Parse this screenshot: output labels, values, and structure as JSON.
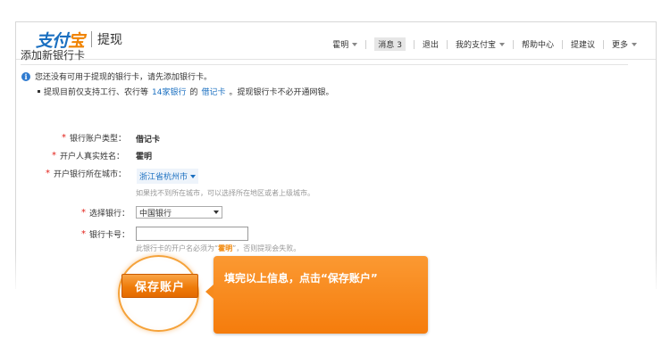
{
  "header": {
    "logo_text_1": "支付",
    "logo_text_2": "宝",
    "section": "提现",
    "nav": {
      "user": "霍明",
      "messages_label": "消息",
      "messages_count": "3",
      "logout": "退出",
      "my_alipay": "我的支付宝",
      "help": "帮助中心",
      "suggest": "提建议",
      "more": "更多"
    }
  },
  "page": {
    "title": "添加新银行卡",
    "notice": "您还没有可用于提现的银行卡，请先添加银行卡。",
    "note_prefix": "提现目前仅支持工行、农行等",
    "note_link1": "14家银行",
    "note_mid": "的",
    "note_link2": "借记卡",
    "note_suffix": "。提现银行卡不必开通网银。"
  },
  "form": {
    "required_mark": "*",
    "account_type_label": "银行账户类型：",
    "account_type_value": "借记卡",
    "holder_label": "开户人真实姓名：",
    "holder_value": "霍明",
    "city_label": "开户银行所在城市：",
    "city_value": "浙江省杭州市",
    "city_hint": "如果找不到所在城市，可以选择所在地区或者上级城市。",
    "bank_label": "选择银行：",
    "bank_value": "中国银行",
    "card_label": "银行卡号：",
    "card_value": "",
    "card_hint_prefix": "此银行卡的开户名必须为“",
    "card_hint_name": "霍明",
    "card_hint_suffix": "”，否则提现会失败。"
  },
  "callout": {
    "save_button": "保存账户",
    "bubble_text": "填完以上信息，点击“保存账户”"
  },
  "colors": {
    "brand_blue": "#1a6fc0",
    "accent_orange": "#f08300",
    "required_red": "#e3221b"
  }
}
